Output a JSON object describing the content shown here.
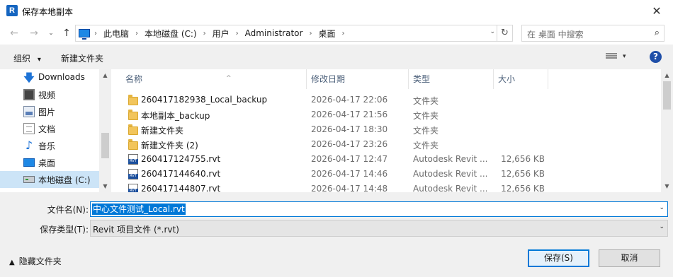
{
  "window": {
    "title": "保存本地副本",
    "app_icon": "R",
    "close": "✕"
  },
  "nav": {
    "back": "←",
    "forward": "→",
    "recent": "⌄",
    "up": "↑",
    "breadcrumbs": [
      "此电脑",
      "本地磁盘 (C:)",
      "用户",
      "Administrator",
      "桌面"
    ],
    "crumb_sep": "›",
    "dropdown": "⌄",
    "refresh": "↻",
    "search_placeholder": "在 桌面 中搜索",
    "search_icon": "⌕"
  },
  "toolbar": {
    "organize": "组织",
    "organize_caret": "▾",
    "new_folder": "新建文件夹",
    "view_caret": "▾",
    "help": "?"
  },
  "sidebar": {
    "items": [
      {
        "label": "Downloads",
        "icon": "download-icon"
      },
      {
        "label": "视频",
        "icon": "video-icon"
      },
      {
        "label": "图片",
        "icon": "pictures-icon"
      },
      {
        "label": "文档",
        "icon": "documents-icon"
      },
      {
        "label": "音乐",
        "icon": "music-icon"
      },
      {
        "label": "桌面",
        "icon": "desktop-icon"
      },
      {
        "label": "本地磁盘 (C:)",
        "icon": "drive-icon",
        "selected": true
      }
    ],
    "scroll_up": "▲",
    "scroll_down": "▼"
  },
  "columns": {
    "name": "名称",
    "date": "修改日期",
    "type": "类型",
    "size": "大小",
    "sort": "^"
  },
  "files": [
    {
      "name": "260417182938_Local_backup",
      "date": "2026-04-17 22:06",
      "type": "文件夹",
      "size": "",
      "kind": "folder"
    },
    {
      "name": "本地副本_backup",
      "date": "2026-04-17 21:56",
      "type": "文件夹",
      "size": "",
      "kind": "folder"
    },
    {
      "name": "新建文件夹",
      "date": "2026-04-17 18:30",
      "type": "文件夹",
      "size": "",
      "kind": "folder"
    },
    {
      "name": "新建文件夹 (2)",
      "date": "2026-04-17 23:26",
      "type": "文件夹",
      "size": "",
      "kind": "folder"
    },
    {
      "name": "260417124755.rvt",
      "date": "2026-04-17 12:47",
      "type": "Autodesk Revit ...",
      "size": "12,656 KB",
      "kind": "rvt"
    },
    {
      "name": "260417144640.rvt",
      "date": "2026-04-17 14:46",
      "type": "Autodesk Revit ...",
      "size": "12,656 KB",
      "kind": "rvt"
    },
    {
      "name": "260417144807.rvt",
      "date": "2026-04-17 14:48",
      "type": "Autodesk Revit ...",
      "size": "12,656 KB",
      "kind": "rvt"
    }
  ],
  "form": {
    "filename_label": "文件名(N):",
    "filename_value": "中心文件测试_Local.rvt",
    "filetype_label": "保存类型(T):",
    "filetype_value": "Revit 项目文件 (*.rvt)",
    "dropdown": "⌄"
  },
  "footer": {
    "hide_folders": "隐藏文件夹",
    "hide_caret": "▲",
    "save": "保存(S)",
    "cancel": "取消"
  }
}
